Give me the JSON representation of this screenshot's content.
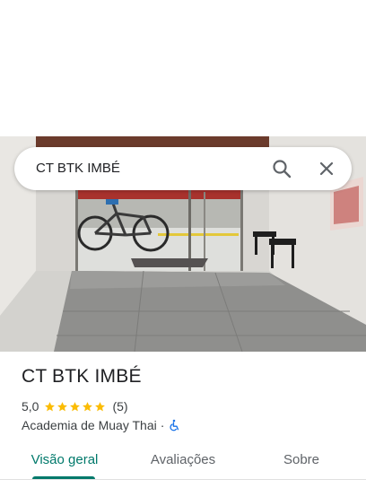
{
  "search": {
    "query": "CT BTK IMBÉ",
    "search_icon": "search-icon",
    "close_icon": "close-icon"
  },
  "place": {
    "name": "CT BTK IMBÉ",
    "rating": "5,0",
    "rating_fraction": 1.0,
    "stars_total": 5,
    "review_count": "(5)",
    "category": "Academia de Muay Thai",
    "separator": "·",
    "accessibility_icon": "wheelchair-icon"
  },
  "tabs": [
    {
      "label": "Visão geral",
      "active": true
    },
    {
      "label": "Avaliações",
      "active": false
    },
    {
      "label": "Sobre",
      "active": false
    }
  ],
  "colors": {
    "accent": "#00796b",
    "star": "#fbbc04",
    "accessibility": "#1a73e8"
  }
}
